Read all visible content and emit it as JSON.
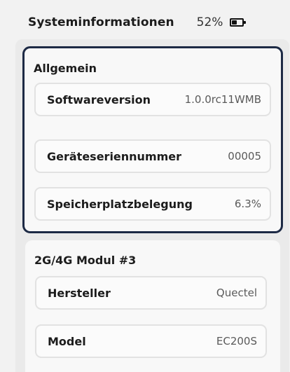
{
  "header": {
    "title": "Systeminformationen",
    "battery_percent_text": "52%",
    "battery_level": 0.52,
    "battery_icon": "battery-icon"
  },
  "sections": [
    {
      "title": "Allgemein",
      "selected": true,
      "rows": [
        {
          "label": "Softwareversion",
          "value": "1.0.0rc11WMB"
        },
        {
          "label": "Geräteseriennummer",
          "value": "00005"
        },
        {
          "label": "Speicherplatzbelegung",
          "value": "6.3%"
        }
      ]
    },
    {
      "title": "2G/4G Modul #3",
      "selected": false,
      "rows": [
        {
          "label": "Hersteller",
          "value": "Quectel"
        },
        {
          "label": "Model",
          "value": "EC200S"
        }
      ]
    }
  ],
  "colors": {
    "background": "#f2f2f2",
    "panel": "#eaeaea",
    "card": "#f8f8f8",
    "selection_border": "#1d2a45",
    "row_border": "#e2e2e2"
  }
}
